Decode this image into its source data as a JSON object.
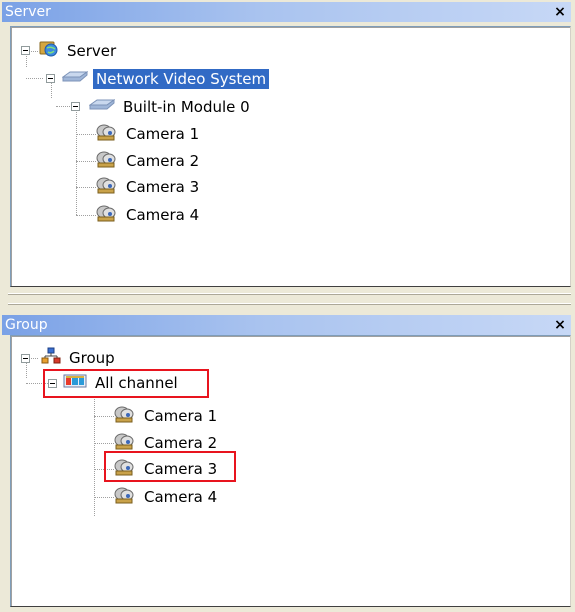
{
  "server_panel": {
    "title": "Server",
    "close_label": "×",
    "nodes": {
      "root": "Server",
      "system": "Network Video System",
      "module": "Built-in Module 0",
      "camera1": "Camera 1",
      "camera2": "Camera 2",
      "camera3": "Camera 3",
      "camera4": "Camera 4"
    }
  },
  "group_panel": {
    "title": "Group",
    "close_label": "×",
    "nodes": {
      "root": "Group",
      "all_channel": "All channel",
      "camera1": "Camera 1",
      "camera2": "Camera 2",
      "camera3": "Camera 3",
      "camera4": "Camera 4"
    }
  },
  "selected_node": "Network Video System",
  "highlight_color": "#e8141e",
  "selection_color": "#316ac5",
  "icons": {
    "server_root": "globe-server-icon",
    "network": "network-icon",
    "module": "network-icon",
    "camera": "camera-icon",
    "group_root": "group-icon",
    "channel": "channel-icon"
  }
}
